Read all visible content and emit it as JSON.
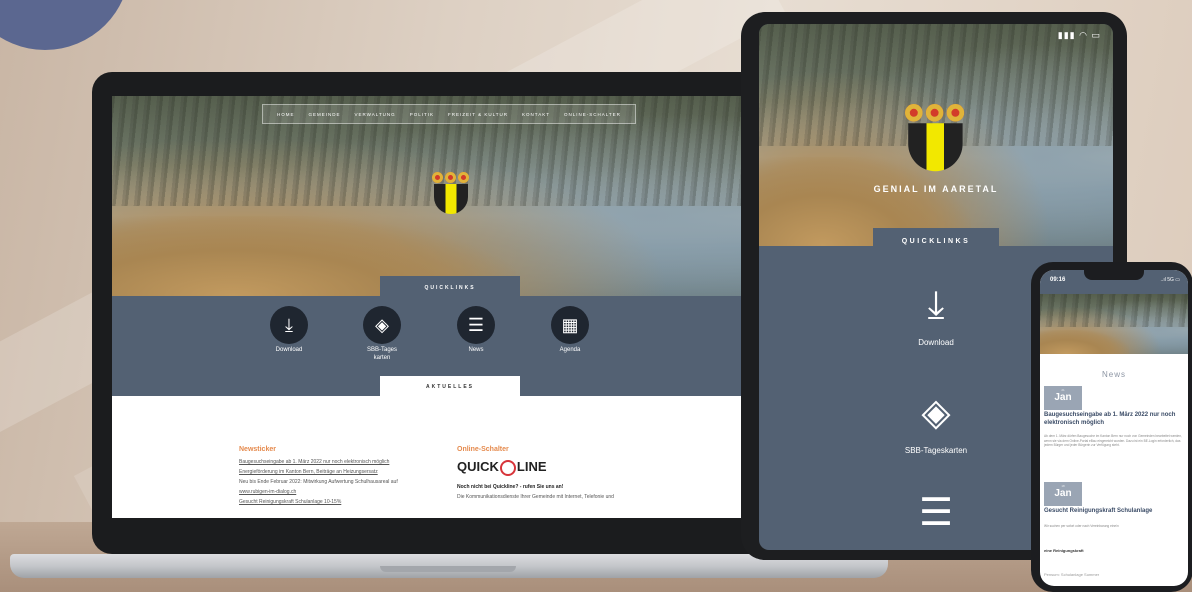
{
  "laptop": {
    "nav": [
      "HOME",
      "GEMEINDE",
      "VERWALTUNG",
      "POLITIK",
      "FREIZEIT & KULTUR",
      "KONTAKT",
      "ONLINE-SCHALTER"
    ],
    "quicklinks_tab": "QUICKLINKS",
    "quicklinks": [
      {
        "label": "Download",
        "icon": "download-icon"
      },
      {
        "label": "SBB-Tageskarten",
        "icon": "ticket-icon"
      },
      {
        "label": "News",
        "icon": "list-icon"
      },
      {
        "label": "Agenda",
        "icon": "calendar-icon"
      }
    ],
    "aktuelles_tab": "AKTUELLES",
    "newsticker": {
      "title": "Newsticker",
      "items": [
        "Baugesuchseingabe ab 1. März 2022 nur noch elektronisch möglich",
        "Energieförderung im Kanton Bern, Beiträge an Heizungsersatz",
        "Neu bis Ende Februar 2022: Mitwirkung Aufwertung Schulhausareal auf",
        "www.rubigen-im-dialog.ch",
        "Gesucht Reinigungskraft Schulanlage 10-15%"
      ]
    },
    "online_schalter": {
      "title": "Online-Schalter",
      "logo_left": "QUICK",
      "logo_right": "LINE",
      "bold": "Noch nicht bei Quickline? - rufen Sie uns an!",
      "text": "Die Kommunikationsdienste Ihrer Gemeinde mit Internet, Telefonie und"
    }
  },
  "tablet": {
    "status": "▮▮▮ ◠ ▭",
    "slogan": "GENIAL IM AARETAL",
    "quicklinks_tab": "QUICKLINKS",
    "quicklinks": [
      {
        "label": "Download",
        "icon": "download-icon"
      },
      {
        "label": "SBB-Tageskarten",
        "icon": "ticket-icon"
      },
      {
        "label": "",
        "icon": "list-icon"
      }
    ]
  },
  "phone": {
    "time": "09:16",
    "signal": "..ıl 5G ▭",
    "news_title": "News",
    "items": [
      {
        "day": "21",
        "month": "Jan",
        "title": "Baugesuchseingabe ab 1. März 2022 nur noch elektronisch möglich",
        "text": "Ab dem 1. März dürfen Baugesuche im Kanton Bern nur noch von Gemeinden bearbeitet werden, wenn sie via dem Online-Portal eBau eingereicht wurden. Dazu ist ein BE-Login erforderlich, das jedem Bürger und jeder Bürgerin zur Verfügung steht."
      },
      {
        "day": "18",
        "month": "Jan",
        "title": "Gesucht Reinigungskraft Schulanlage",
        "text": "Wir suchen per sofort oder nach Vereinbarung eine/n"
      }
    ],
    "bold": "eine Reinigungskraft",
    "grey": "Pensum: Schulanlage Summer"
  },
  "colors": {
    "band": "#536173",
    "accent": "#e58a4d",
    "crest_yellow": "#f2e800",
    "background": "#ddd0c3"
  }
}
